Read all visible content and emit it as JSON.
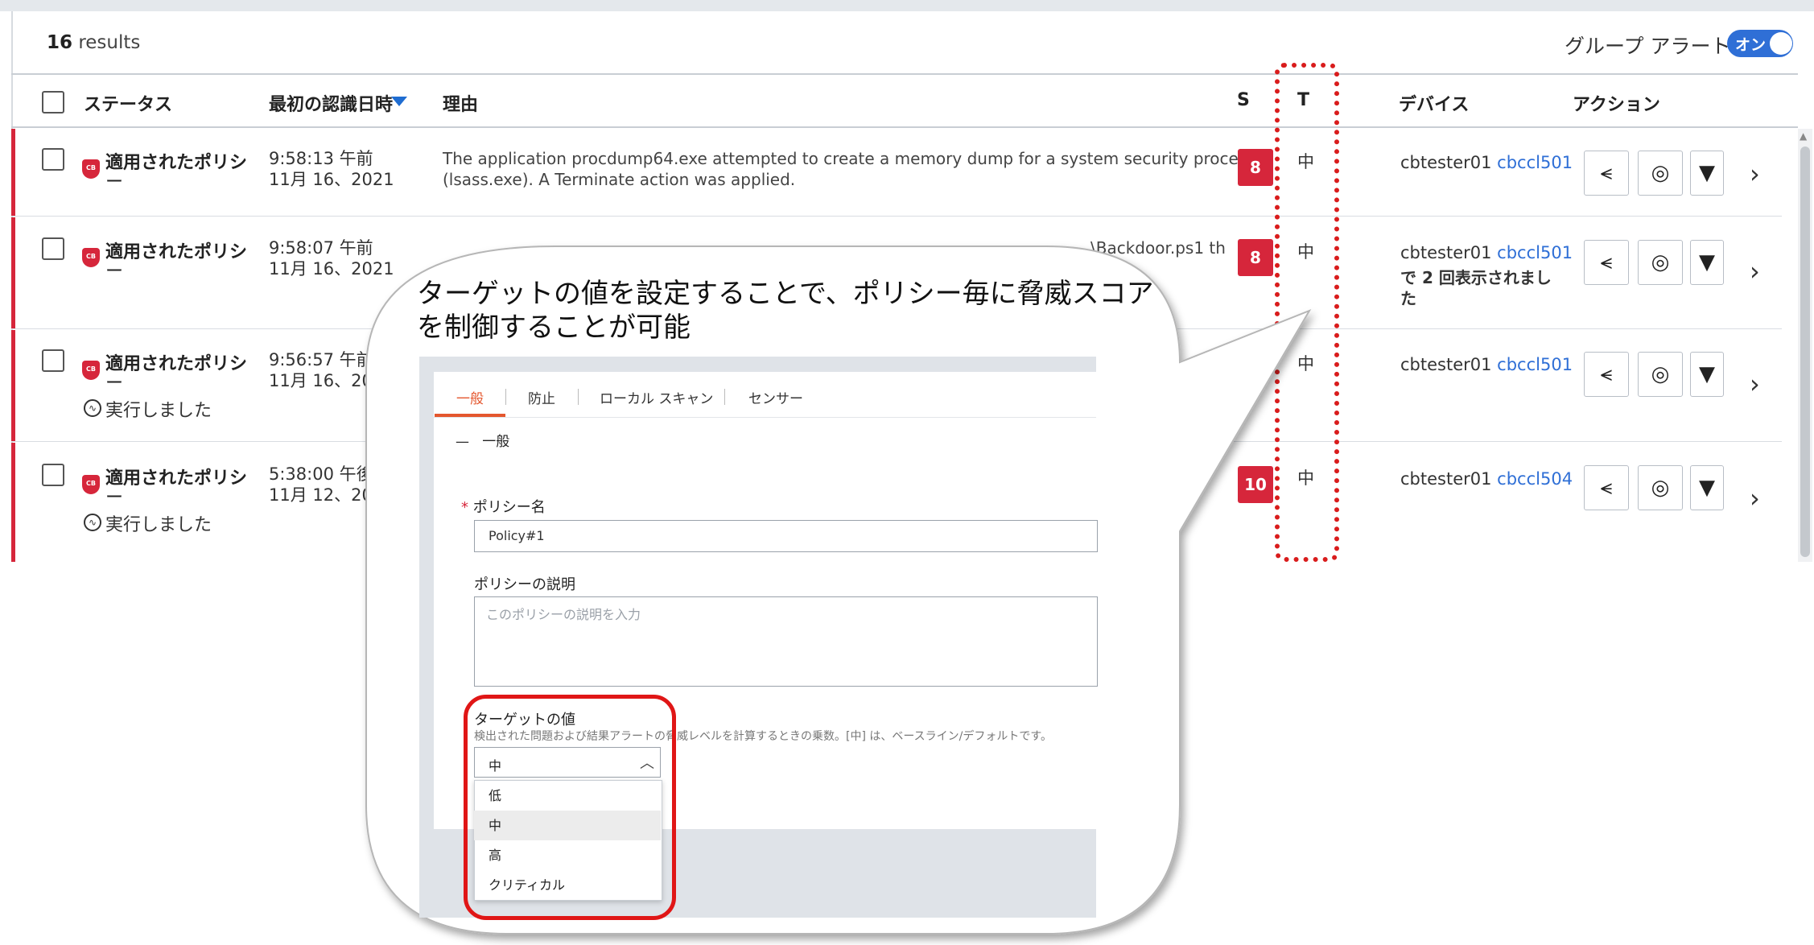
{
  "header": {
    "results_count": "16",
    "results_label": " results",
    "group_alert_label": "グループ アラート",
    "group_alert_toggle": "オン"
  },
  "columns": {
    "status": "ステータス",
    "first_seen": "最初の認識日時",
    "reason": "理由",
    "s": "S",
    "t": "T",
    "device": "デバイス",
    "actions": "アクション"
  },
  "rows": [
    {
      "status": "適用されたポリシ",
      "status_cont": "ー",
      "ran": "",
      "time": "9:58:13 午前",
      "date": "11月 16、2021",
      "reason_line1": "The application procdump64.exe attempted to create a memory dump for a system security process",
      "reason_line2": "(lsass.exe). A Terminate action was applied.",
      "severity": "8",
      "target": "中",
      "device_user": "cbtester01",
      "device_link": "cbccl501",
      "device_note1": "",
      "device_note2": ""
    },
    {
      "status": "適用されたポリシ",
      "status_cont": "ー",
      "ran": "",
      "time": "9:58:07 午前",
      "date": "11月 16、2021",
      "reason_line1": "…\\Backdoor.ps1 th",
      "reason_line2": "",
      "severity": "8",
      "target": "中",
      "device_user": "cbtester01",
      "device_link": "cbccl501",
      "device_note1": "で 2 回表示されまし",
      "device_note2": "た"
    },
    {
      "status": "適用されたポリシ",
      "status_cont": "ー",
      "ran": "実行しました",
      "time": "9:56:57 午前",
      "date": "11月 16、20",
      "reason_line1": "",
      "reason_line2": "",
      "severity": "",
      "target": "中",
      "device_user": "cbtester01",
      "device_link": "cbccl501",
      "device_note1": "",
      "device_note2": ""
    },
    {
      "status": "適用されたポリシ",
      "status_cont": "ー",
      "ran": "実行しました",
      "time": "5:38:00 午後",
      "date": "11月 12、20",
      "reason_line1": "",
      "reason_line2": "",
      "severity": "10",
      "target": "中",
      "device_user": "cbtester01",
      "device_link": "cbccl504",
      "device_note1": "",
      "device_note2": ""
    }
  ],
  "callout": {
    "line1": "ターゲットの値を設定することで、ポリシー毎に脅威スコア",
    "line2": "を制御することが可能"
  },
  "policy": {
    "tabs": [
      "一般",
      "防止",
      "ローカル スキャン",
      "センサー"
    ],
    "section": "一般",
    "section_dash": "—",
    "name_label": "ポリシー名",
    "name_required": "*",
    "name_value": "Policy#1",
    "desc_label": "ポリシーの説明",
    "desc_placeholder": "このポリシーの説明を入力",
    "target_label": "ターゲットの値",
    "target_help": "検出された問題および結果アラートの脅威レベルを計算するときの乗数。[中] は、ベースライン/デフォルトです。",
    "target_value": "中",
    "options": [
      "低",
      "中",
      "高",
      "クリティカル"
    ]
  },
  "colors": {
    "accent_blue": "#2f6fd6",
    "severity_red": "#d6263b",
    "highlight_red": "#e01616",
    "tab_orange": "#e4572e"
  }
}
